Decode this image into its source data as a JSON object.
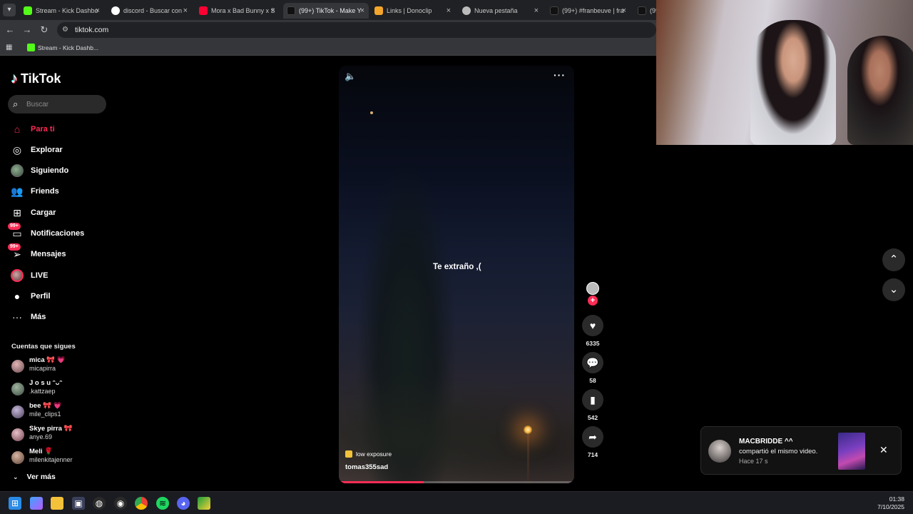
{
  "browser": {
    "tabs": [
      {
        "label": "Stream - Kick Dashbo",
        "color": "#53fc18"
      },
      {
        "label": "discord - Buscar con",
        "color": "#ffffff"
      },
      {
        "label": "Mora x Bad Bunny x S",
        "color": "#ff0033"
      },
      {
        "label": "(99+) TikTok - Make Y",
        "color": "#111111"
      },
      {
        "label": "Links | Donoclip",
        "color": "#f4a52b"
      },
      {
        "label": "Nueva pestaña",
        "color": "#bbbbbb"
      },
      {
        "label": "(99+) #franbeuve | fra",
        "color": "#111111"
      },
      {
        "label": "(99",
        "color": "#111111"
      }
    ],
    "tab_close": "×",
    "url": "tiktok.com",
    "bookmark": "Stream - Kick Dashb..."
  },
  "tiktok": {
    "logo": "TikTok",
    "search_placeholder": "Buscar",
    "nav": [
      {
        "label": "Para ti",
        "icon": "home-icon"
      },
      {
        "label": "Explorar",
        "icon": "compass-icon"
      },
      {
        "label": "Siguiendo",
        "icon": "following-avatar"
      },
      {
        "label": "Friends",
        "icon": "friends-icon"
      },
      {
        "label": "Cargar",
        "icon": "upload-icon"
      },
      {
        "label": "Notificaciones",
        "icon": "inbox-icon",
        "badge": "99+"
      },
      {
        "label": "Mensajes",
        "icon": "messages-icon",
        "badge": "99+"
      },
      {
        "label": "LIVE",
        "icon": "live-avatar"
      },
      {
        "label": "Perfil",
        "icon": "profile-icon"
      },
      {
        "label": "Más",
        "icon": "more-icon"
      }
    ],
    "following_title": "Cuentas que sigues",
    "following": [
      {
        "name": "mica 🎀 💗",
        "user": "micapirra"
      },
      {
        "name": "J o s u ᵔᴗᵔ",
        "user": ".kattzaep"
      },
      {
        "name": "bee 🎀 💗",
        "user": "mile_clips1"
      },
      {
        "name": "Skye pirra 🎀",
        "user": "anye.69"
      },
      {
        "name": "Meli 🌹",
        "user": "milenkitajenner"
      }
    ],
    "see_more": "Ver más"
  },
  "video": {
    "caption": "Te extraño ,(",
    "tag": "low exposure",
    "username": "tomas355sad",
    "progress": 0.36,
    "actions": {
      "likes": "6335",
      "comments": "58",
      "saves": "542",
      "shares": "714"
    }
  },
  "toast": {
    "name": "MACBRIDDE ^^",
    "message": "compartió el mismo video.",
    "time": "Hace 17 s"
  },
  "taskbar": {
    "time": "01:38",
    "date": "7/10/2025"
  },
  "colors": {
    "accent": "#fe2c55",
    "kick": "#53fc18"
  }
}
